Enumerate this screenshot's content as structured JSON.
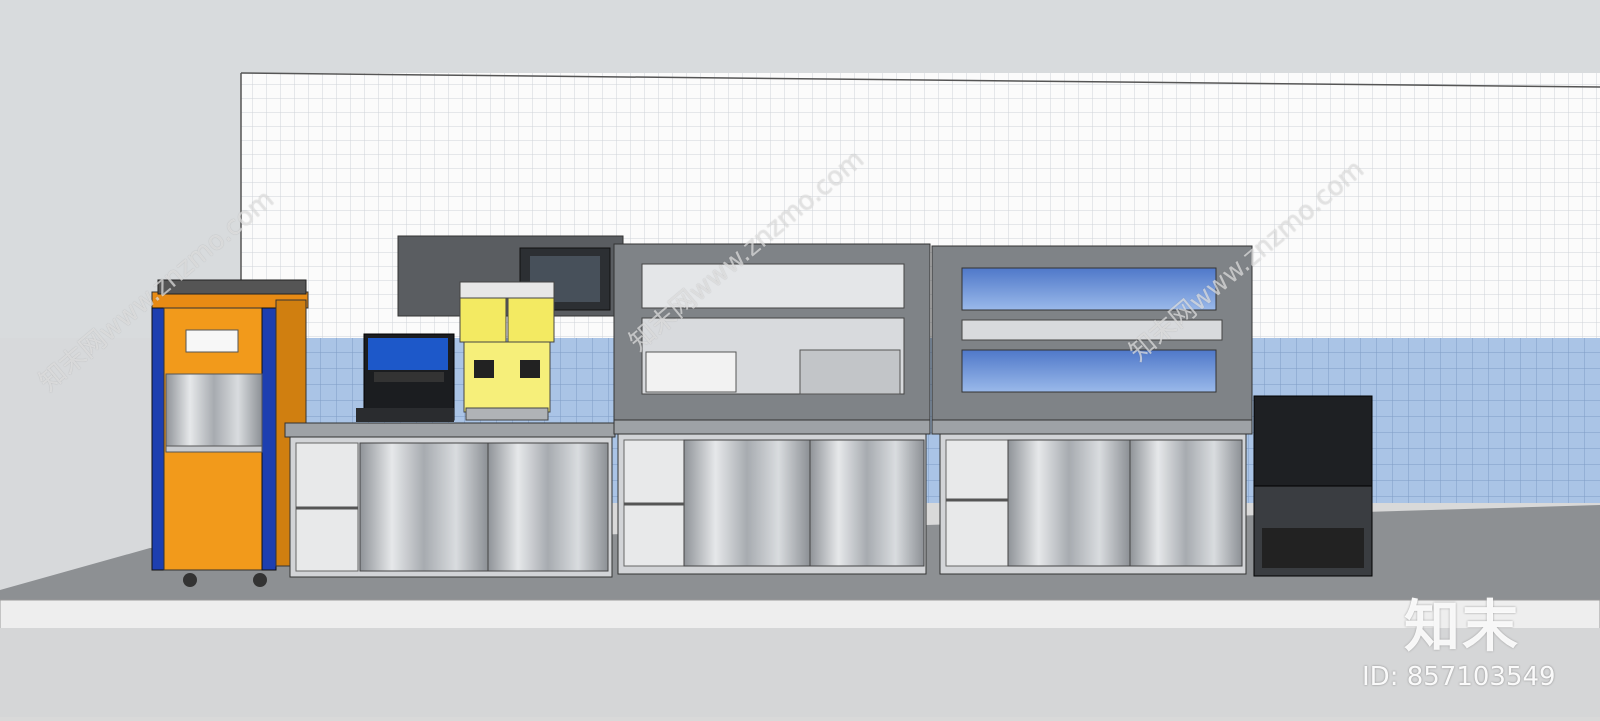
{
  "watermark": {
    "logo_text": "知末",
    "id_text": "ID: 857103549",
    "diagonal_text": "知末网www.znzmo.com",
    "url_text": "www.znzmo.com"
  },
  "colors": {
    "sky": "#d7dadc",
    "wall_white": "#fbfbfb",
    "tile_blue": "#a9c3e6",
    "floor": "#8d8f92",
    "steel": "#b9bcc0",
    "machine_orange": "#f29a1b",
    "machine_blue": "#1d3fb0",
    "juice_yellow": "#f3ea62"
  }
}
